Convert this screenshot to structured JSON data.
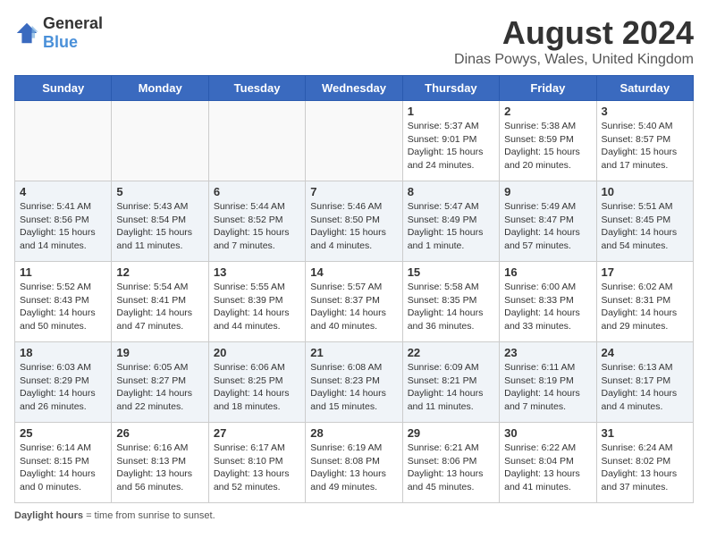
{
  "header": {
    "logo_general": "General",
    "logo_blue": "Blue",
    "main_title": "August 2024",
    "subtitle": "Dinas Powys, Wales, United Kingdom"
  },
  "footer": {
    "label": "Daylight hours"
  },
  "days_of_week": [
    "Sunday",
    "Monday",
    "Tuesday",
    "Wednesday",
    "Thursday",
    "Friday",
    "Saturday"
  ],
  "weeks": [
    [
      {
        "day": "",
        "info": ""
      },
      {
        "day": "",
        "info": ""
      },
      {
        "day": "",
        "info": ""
      },
      {
        "day": "",
        "info": ""
      },
      {
        "day": "1",
        "info": "Sunrise: 5:37 AM\nSunset: 9:01 PM\nDaylight: 15 hours\nand 24 minutes."
      },
      {
        "day": "2",
        "info": "Sunrise: 5:38 AM\nSunset: 8:59 PM\nDaylight: 15 hours\nand 20 minutes."
      },
      {
        "day": "3",
        "info": "Sunrise: 5:40 AM\nSunset: 8:57 PM\nDaylight: 15 hours\nand 17 minutes."
      }
    ],
    [
      {
        "day": "4",
        "info": "Sunrise: 5:41 AM\nSunset: 8:56 PM\nDaylight: 15 hours\nand 14 minutes."
      },
      {
        "day": "5",
        "info": "Sunrise: 5:43 AM\nSunset: 8:54 PM\nDaylight: 15 hours\nand 11 minutes."
      },
      {
        "day": "6",
        "info": "Sunrise: 5:44 AM\nSunset: 8:52 PM\nDaylight: 15 hours\nand 7 minutes."
      },
      {
        "day": "7",
        "info": "Sunrise: 5:46 AM\nSunset: 8:50 PM\nDaylight: 15 hours\nand 4 minutes."
      },
      {
        "day": "8",
        "info": "Sunrise: 5:47 AM\nSunset: 8:49 PM\nDaylight: 15 hours\nand 1 minute."
      },
      {
        "day": "9",
        "info": "Sunrise: 5:49 AM\nSunset: 8:47 PM\nDaylight: 14 hours\nand 57 minutes."
      },
      {
        "day": "10",
        "info": "Sunrise: 5:51 AM\nSunset: 8:45 PM\nDaylight: 14 hours\nand 54 minutes."
      }
    ],
    [
      {
        "day": "11",
        "info": "Sunrise: 5:52 AM\nSunset: 8:43 PM\nDaylight: 14 hours\nand 50 minutes."
      },
      {
        "day": "12",
        "info": "Sunrise: 5:54 AM\nSunset: 8:41 PM\nDaylight: 14 hours\nand 47 minutes."
      },
      {
        "day": "13",
        "info": "Sunrise: 5:55 AM\nSunset: 8:39 PM\nDaylight: 14 hours\nand 44 minutes."
      },
      {
        "day": "14",
        "info": "Sunrise: 5:57 AM\nSunset: 8:37 PM\nDaylight: 14 hours\nand 40 minutes."
      },
      {
        "day": "15",
        "info": "Sunrise: 5:58 AM\nSunset: 8:35 PM\nDaylight: 14 hours\nand 36 minutes."
      },
      {
        "day": "16",
        "info": "Sunrise: 6:00 AM\nSunset: 8:33 PM\nDaylight: 14 hours\nand 33 minutes."
      },
      {
        "day": "17",
        "info": "Sunrise: 6:02 AM\nSunset: 8:31 PM\nDaylight: 14 hours\nand 29 minutes."
      }
    ],
    [
      {
        "day": "18",
        "info": "Sunrise: 6:03 AM\nSunset: 8:29 PM\nDaylight: 14 hours\nand 26 minutes."
      },
      {
        "day": "19",
        "info": "Sunrise: 6:05 AM\nSunset: 8:27 PM\nDaylight: 14 hours\nand 22 minutes."
      },
      {
        "day": "20",
        "info": "Sunrise: 6:06 AM\nSunset: 8:25 PM\nDaylight: 14 hours\nand 18 minutes."
      },
      {
        "day": "21",
        "info": "Sunrise: 6:08 AM\nSunset: 8:23 PM\nDaylight: 14 hours\nand 15 minutes."
      },
      {
        "day": "22",
        "info": "Sunrise: 6:09 AM\nSunset: 8:21 PM\nDaylight: 14 hours\nand 11 minutes."
      },
      {
        "day": "23",
        "info": "Sunrise: 6:11 AM\nSunset: 8:19 PM\nDaylight: 14 hours\nand 7 minutes."
      },
      {
        "day": "24",
        "info": "Sunrise: 6:13 AM\nSunset: 8:17 PM\nDaylight: 14 hours\nand 4 minutes."
      }
    ],
    [
      {
        "day": "25",
        "info": "Sunrise: 6:14 AM\nSunset: 8:15 PM\nDaylight: 14 hours\nand 0 minutes."
      },
      {
        "day": "26",
        "info": "Sunrise: 6:16 AM\nSunset: 8:13 PM\nDaylight: 13 hours\nand 56 minutes."
      },
      {
        "day": "27",
        "info": "Sunrise: 6:17 AM\nSunset: 8:10 PM\nDaylight: 13 hours\nand 52 minutes."
      },
      {
        "day": "28",
        "info": "Sunrise: 6:19 AM\nSunset: 8:08 PM\nDaylight: 13 hours\nand 49 minutes."
      },
      {
        "day": "29",
        "info": "Sunrise: 6:21 AM\nSunset: 8:06 PM\nDaylight: 13 hours\nand 45 minutes."
      },
      {
        "day": "30",
        "info": "Sunrise: 6:22 AM\nSunset: 8:04 PM\nDaylight: 13 hours\nand 41 minutes."
      },
      {
        "day": "31",
        "info": "Sunrise: 6:24 AM\nSunset: 8:02 PM\nDaylight: 13 hours\nand 37 minutes."
      }
    ]
  ]
}
